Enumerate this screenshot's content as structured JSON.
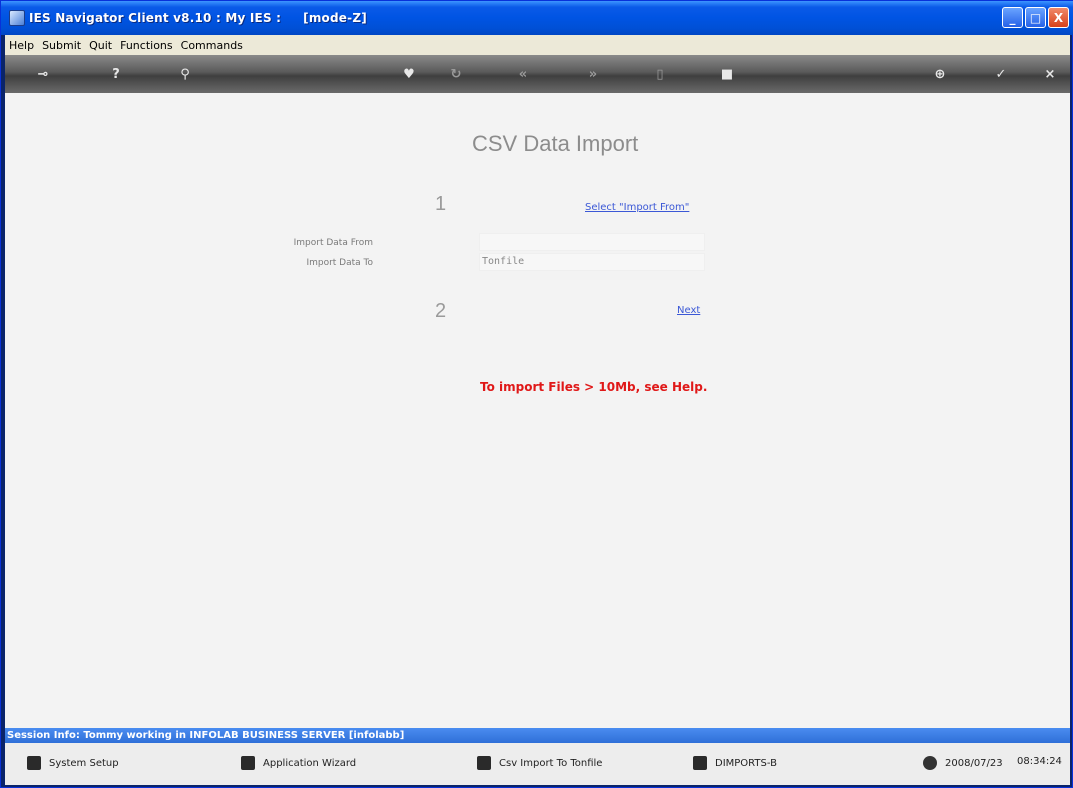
{
  "window": {
    "title": "IES Navigator Client v8.10 : My IES :",
    "mode": "[mode-Z]",
    "controls": {
      "minimize": "_",
      "maximize": "□",
      "close": "X"
    }
  },
  "menu": {
    "items": [
      "Help",
      "Submit",
      "Quit",
      "Functions",
      "Commands"
    ]
  },
  "toolbar": {
    "icons": [
      "key-icon",
      "help-icon",
      "search-icon",
      "heart-icon",
      "refresh-icon",
      "rewind-icon",
      "forward-icon",
      "trash-icon",
      "stop-icon",
      "add-icon",
      "check-icon",
      "close-icon"
    ]
  },
  "main": {
    "heading": "CSV Data Import",
    "step1": {
      "number": "1",
      "link": "Select \"Import From\""
    },
    "fields": {
      "import_from_label": "Import Data From",
      "import_from_value": "",
      "import_to_label": "Import Data To",
      "import_to_value": "Tonfile"
    },
    "step2": {
      "number": "2",
      "link": "Next"
    },
    "warning": "To import Files > 10Mb, see Help."
  },
  "session": {
    "info": "Session Info: Tommy working in INFOLAB BUSINESS SERVER [infolabb]"
  },
  "taskbar": {
    "items": [
      "System Setup",
      "Application Wizard",
      "Csv Import To Tonfile",
      "DIMPORTS-B"
    ],
    "date": "2008/07/23",
    "time": "08:34:24"
  }
}
